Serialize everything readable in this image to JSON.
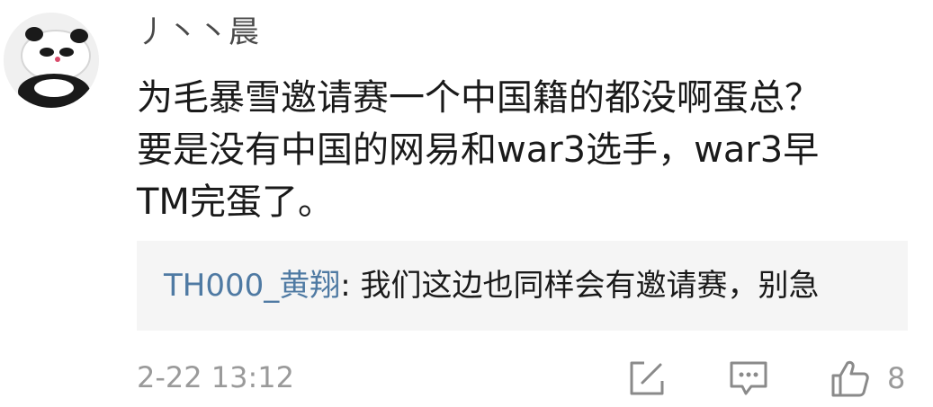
{
  "comment": {
    "username": "丿丶丶晨",
    "content_lines": [
      "为毛暴雪邀请赛一个中国籍的都没啊蛋总？",
      "要是没有中国的网易和war3选手，war3早",
      "TM完蛋了。"
    ],
    "reply": {
      "author": "TH000_黄翔",
      "separator": ": ",
      "text": "我们这边也同样会有邀请赛，别急"
    },
    "timestamp": "2-22 13:12",
    "like_count": "8",
    "icons": {
      "edit": "edit-icon",
      "reply": "comment-icon",
      "like": "thumbs-up-icon"
    },
    "colors": {
      "reply_author": "#4f7aa3",
      "reply_background": "#f5f5f5",
      "meta_text": "#9a9a9a"
    }
  }
}
